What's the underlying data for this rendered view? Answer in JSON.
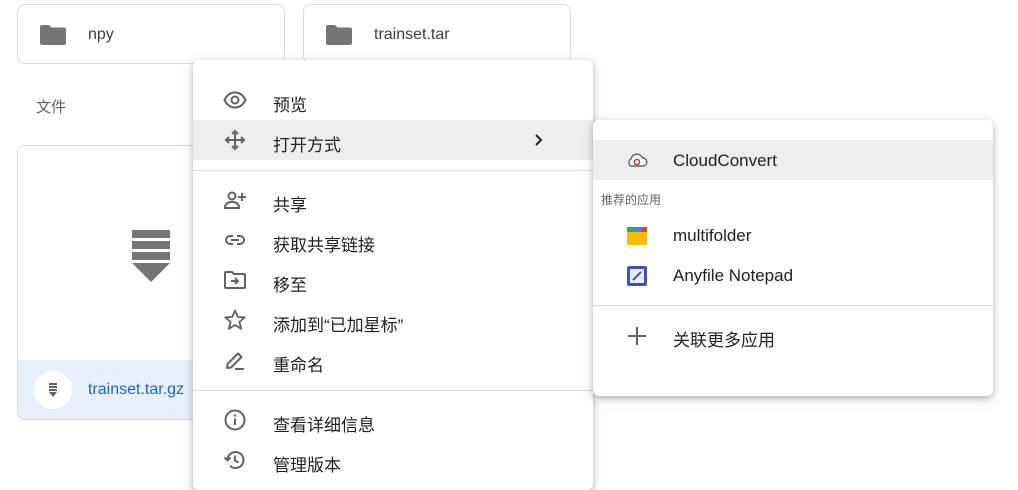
{
  "folders": [
    {
      "name": "npy",
      "icon": "folder-icon"
    },
    {
      "name": "trainset.tar",
      "icon": "folder-icon"
    }
  ],
  "files_section_label": "文件",
  "file": {
    "name": "trainset.tar.gz",
    "icon": "archive-icon"
  },
  "context_menu": {
    "items": [
      {
        "label": "预览",
        "icon": "eye-icon"
      },
      {
        "label": "打开方式",
        "icon": "move-arrows-icon",
        "has_submenu": true
      },
      {
        "label": "共享",
        "icon": "person-add-icon"
      },
      {
        "label": "获取共享链接",
        "icon": "link-icon"
      },
      {
        "label": "移至",
        "icon": "move-to-folder-icon"
      },
      {
        "label": "添加到“已加星标”",
        "icon": "star-icon"
      },
      {
        "label": "重命名",
        "icon": "pencil-icon"
      },
      {
        "label": "查看详细信息",
        "icon": "info-icon"
      },
      {
        "label": "管理版本",
        "icon": "history-icon"
      }
    ]
  },
  "open_with_submenu": {
    "top_app": {
      "label": "CloudConvert",
      "icon": "cloudconvert-icon"
    },
    "recommended_heading": "推荐的应用",
    "apps": [
      {
        "label": "multifolder",
        "icon": "multifolder-icon"
      },
      {
        "label": "Anyfile Notepad",
        "icon": "anyfile-notepad-icon"
      }
    ],
    "connect_more": {
      "label": "关联更多应用",
      "icon": "plus-icon"
    }
  },
  "colors": {
    "selected_bg": "#e8f0fe",
    "link_blue": "#1967d2",
    "icon_gray": "#5f6368"
  }
}
